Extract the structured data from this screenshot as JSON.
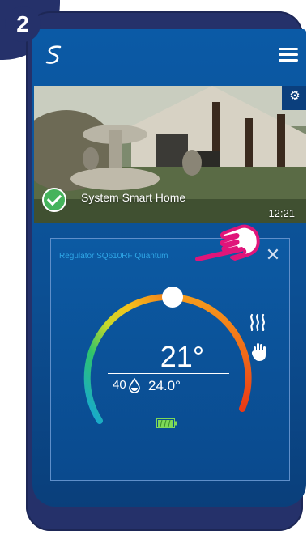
{
  "step": {
    "number": "2"
  },
  "home": {
    "name": "System Smart Home",
    "time": "12:21"
  },
  "thermostat": {
    "title": "Regulator SQ610RF Quantum",
    "current_temp": "21°",
    "humidity": "40",
    "set_temp": "24.0°"
  },
  "colors": {
    "frame": "#25316a",
    "screen": "#0b5aa6",
    "panel_title": "#2fa6e6",
    "highlight": "#e0157a",
    "check": "#45b35c"
  },
  "icons": [
    "logo-icon",
    "menu-icon",
    "gear-icon",
    "check-icon",
    "close-icon",
    "drop-icon",
    "battery-icon",
    "heat-icon",
    "hand-icon",
    "pointer-hand-icon"
  ]
}
